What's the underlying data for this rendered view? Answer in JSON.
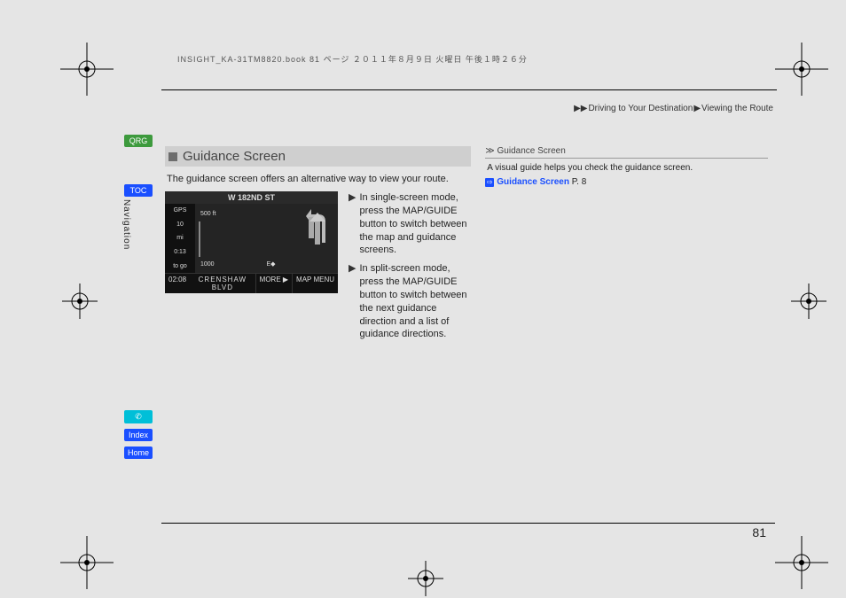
{
  "header_stamp": "INSIGHT_KA-31TM8820.book  81 ページ   ２０１１年８月９日   火曜日   午後１時２６分",
  "breadcrumb": {
    "a": "Driving to Your Destination",
    "b": "Viewing the Route"
  },
  "rail": {
    "qrg": "QRG",
    "toc": "TOC",
    "voice_icon": "✆",
    "index": "Index",
    "home": "Home"
  },
  "vertical_nav_label": "Navigation",
  "section": {
    "title": "Guidance Screen",
    "intro": "The guidance screen offers an alternative way to view your route.",
    "bullets": [
      "In single-screen mode, press the MAP/GUIDE button to switch between the map and guidance screens.",
      "In split-screen mode, press the MAP/GUIDE button to switch between the next guidance direction and a list of guidance directions."
    ]
  },
  "device": {
    "header": "W 182ND ST",
    "left": [
      "GPS",
      "10",
      "mi",
      "0:13",
      "to go"
    ],
    "scale": [
      "500 ft",
      "1000"
    ],
    "compass": "E",
    "footer_time": "02:08",
    "footer_street": "CRENSHAW BLVD",
    "footer_menu1": "MORE ▶",
    "footer_menu2": "MAP MENU"
  },
  "sidebar": {
    "title": "Guidance Screen",
    "body": "A visual guide helps you check the guidance screen.",
    "xref_label": "Guidance Screen",
    "xref_page": "P.  8"
  },
  "page_number": "81"
}
